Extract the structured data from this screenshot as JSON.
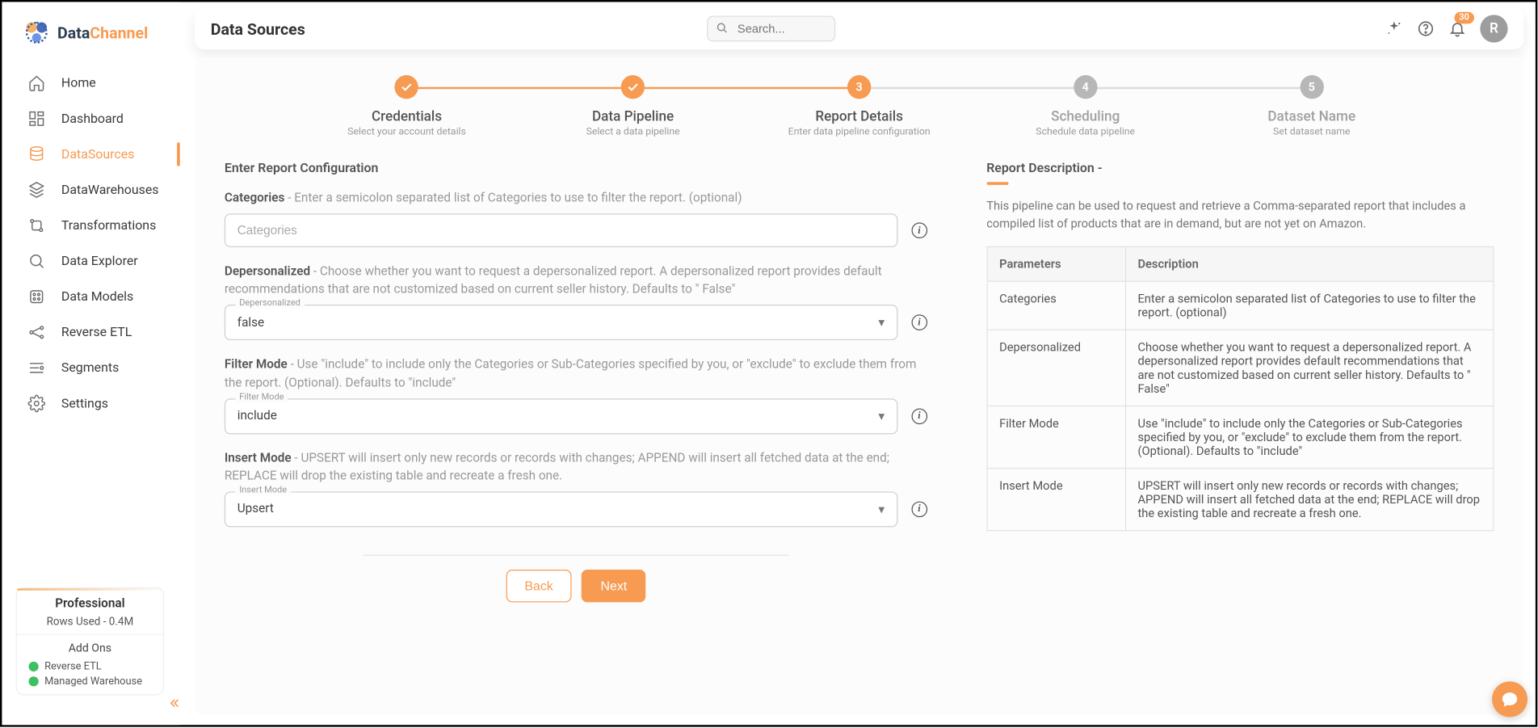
{
  "brand": {
    "name1": "Data",
    "name2": "Channel"
  },
  "header": {
    "title": "Data Sources",
    "search_placeholder": "Search...",
    "badge": "30",
    "avatar_initial": "R"
  },
  "nav": {
    "home": "Home",
    "dashboard": "Dashboard",
    "datasources": "DataSources",
    "datawarehouses": "DataWarehouses",
    "transformations": "Transformations",
    "dataexplorer": "Data Explorer",
    "datamodels": "Data Models",
    "reverseetl": "Reverse ETL",
    "segments": "Segments",
    "settings": "Settings"
  },
  "plan": {
    "title": "Professional",
    "rows_used": "Rows Used - 0.4M",
    "addons_label": "Add Ons",
    "addon1": "Reverse ETL",
    "addon2": "Managed Warehouse"
  },
  "stepper": {
    "s1": {
      "title": "Credentials",
      "sub": "Select your account details"
    },
    "s2": {
      "title": "Data Pipeline",
      "sub": "Select a data pipeline"
    },
    "s3": {
      "num": "3",
      "title": "Report Details",
      "sub": "Enter data pipeline configuration"
    },
    "s4": {
      "num": "4",
      "title": "Scheduling",
      "sub": "Schedule data pipeline"
    },
    "s5": {
      "num": "5",
      "title": "Dataset Name",
      "sub": "Set dataset name"
    }
  },
  "form": {
    "heading": "Enter Report Configuration",
    "categories": {
      "label_lead": "Categories",
      "label_rest": " - Enter a semicolon separated list of Categories to use to filter the report. (optional)",
      "placeholder": "Categories"
    },
    "depersonalized": {
      "label_lead": "Depersonalized",
      "label_rest": " - Choose whether you want to request a depersonalized report. A depersonalized report provides default recommendations that are not customized based on current seller history. Defaults to \" False\"",
      "float": "Depersonalized",
      "value": "false"
    },
    "filtermode": {
      "label_lead": "Filter Mode",
      "label_rest": " - Use \"include\" to include only the Categories or Sub-Categories specified by you, or \"exclude\" to exclude them from the report. (Optional). Defaults to \"include\"",
      "float": "Filter Mode",
      "value": "include"
    },
    "insertmode": {
      "label_lead": "Insert Mode",
      "label_rest": " - UPSERT will insert only new records or records with changes; APPEND will insert all fetched data at the end; REPLACE will drop the existing table and recreate a fresh one.",
      "float": "Insert Mode",
      "value": "Upsert"
    },
    "back": "Back",
    "next": "Next"
  },
  "desc": {
    "title": "Report Description -",
    "text": "This pipeline can be used to request and retrieve a Comma-separated report that includes a compiled list of products that are in demand, but are not yet on Amazon.",
    "th1": "Parameters",
    "th2": "Description",
    "rows": {
      "r1p": "Categories",
      "r1d": "Enter a semicolon separated list of Categories to use to filter the report. (optional)",
      "r2p": "Depersonalized",
      "r2d": "Choose whether you want to request a depersonalized report. A depersonalized report provides default recommendations that are not customized based on current seller history. Defaults to \" False\"",
      "r3p": "Filter Mode",
      "r3d": "Use \"include\" to include only the Categories or Sub-Categories specified by you, or \"exclude\" to exclude them from the report. (Optional). Defaults to \"include\"",
      "r4p": "Insert Mode",
      "r4d": "UPSERT will insert only new records or records with changes; APPEND will insert all fetched data at the end; REPLACE will drop the existing table and recreate a fresh one."
    }
  }
}
